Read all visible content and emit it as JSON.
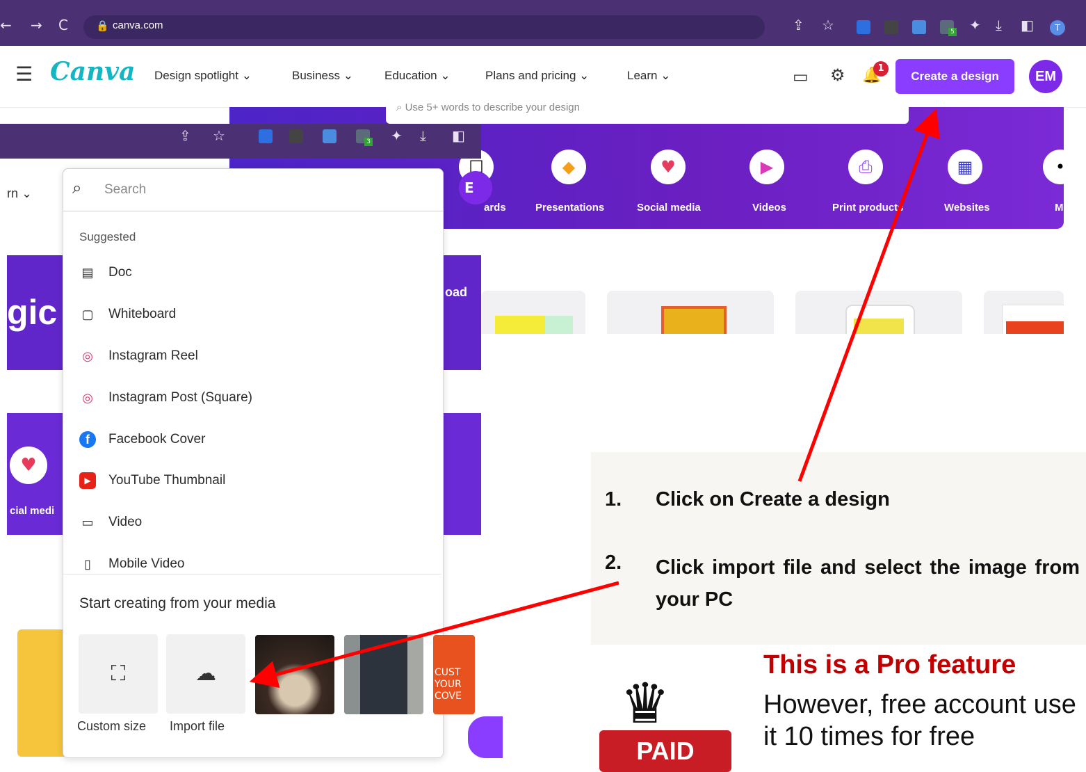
{
  "browser": {
    "url": "canva.com",
    "extension_badge": "5",
    "profile_initial": "T"
  },
  "inset_browser": {
    "extension_badge": "3"
  },
  "header": {
    "logo": "Canva",
    "nav": [
      "Design spotlight",
      "Business",
      "Education",
      "Plans and pricing",
      "Learn"
    ],
    "notification_count": "1",
    "create_button": "Create a design",
    "avatar_initials": "EM"
  },
  "hero": {
    "search_placeholder": "Use 5+ words to describe your design",
    "categories": [
      "ards",
      "Presentations",
      "Social media",
      "Videos",
      "Print products",
      "Websites",
      "M"
    ]
  },
  "background_fragments": {
    "learn": "rn",
    "magic": "gic",
    "upload": "oad",
    "social": "cial medi",
    "avatar_partial": "E"
  },
  "dropdown": {
    "search_placeholder": "Search",
    "suggested_title": "Suggested",
    "suggestions": [
      {
        "label": "Doc",
        "icon": "doc-icon"
      },
      {
        "label": "Whiteboard",
        "icon": "whiteboard-icon"
      },
      {
        "label": "Instagram Reel",
        "icon": "instagram-icon"
      },
      {
        "label": "Instagram Post (Square)",
        "icon": "instagram-icon"
      },
      {
        "label": "Facebook Cover",
        "icon": "facebook-icon"
      },
      {
        "label": "YouTube Thumbnail",
        "icon": "youtube-icon"
      },
      {
        "label": "Video",
        "icon": "video-icon"
      },
      {
        "label": "Mobile Video",
        "icon": "mobile-icon"
      }
    ],
    "media_title": "Start creating from your media",
    "custom_size": "Custom size",
    "import_file": "Import file",
    "thumb_text": "CUST YOUR COVE"
  },
  "instructions": {
    "step1_num": "1.",
    "step1": "Click on Create a design",
    "step2_num": "2.",
    "step2": "Click import file and select the image from your PC"
  },
  "pro": {
    "title": "This is a Pro feature",
    "text": "However, free account use it 10 times for free",
    "badge": "PAID"
  },
  "colors": {
    "canva_purple": "#8b3dff",
    "arrow_red": "#ff0000",
    "pro_red": "#c00000"
  }
}
